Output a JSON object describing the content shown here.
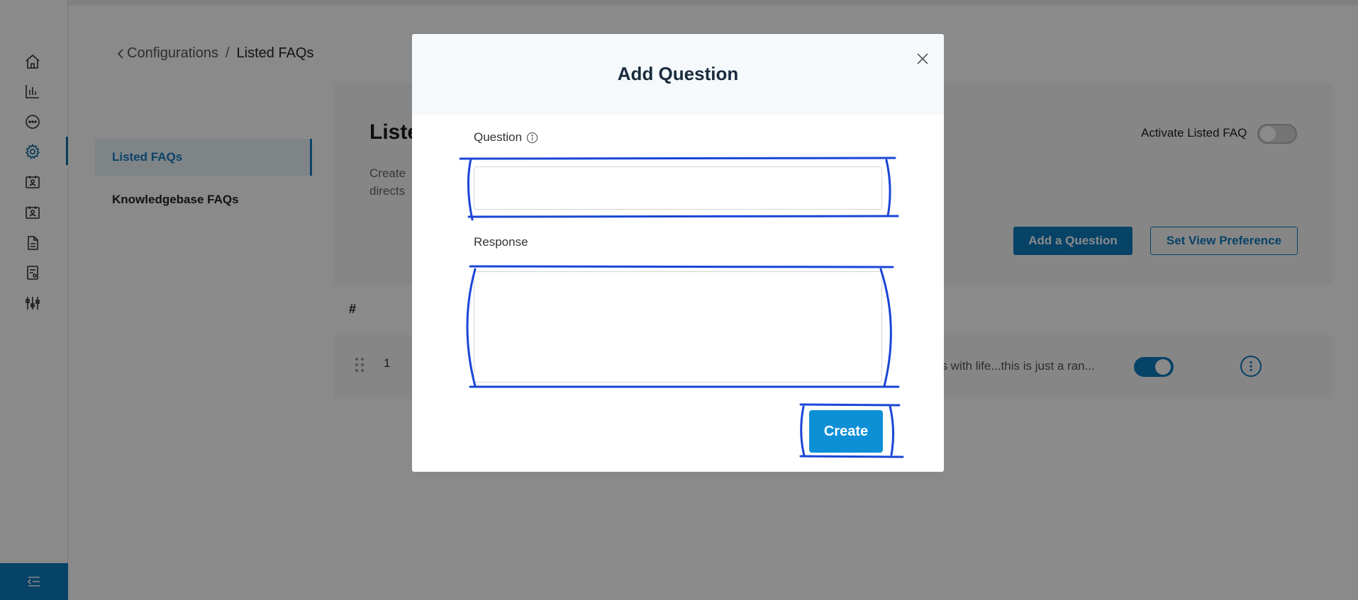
{
  "breadcrumb": {
    "parent": "Configurations",
    "separator": "/",
    "current": "Listed FAQs"
  },
  "sidebar": {
    "items": [
      {
        "icon": "home-icon"
      },
      {
        "icon": "bar-chart-icon"
      },
      {
        "icon": "chat-bubble-icon"
      },
      {
        "icon": "gear-icon",
        "active": true
      },
      {
        "icon": "contact-card-icon"
      },
      {
        "icon": "contact-card-icon"
      },
      {
        "icon": "document-icon"
      },
      {
        "icon": "report-icon"
      },
      {
        "icon": "sliders-icon"
      }
    ],
    "footer_icon": "collapse-menu-icon"
  },
  "subnav": {
    "items": [
      {
        "label": "Listed FAQs",
        "active": true
      },
      {
        "label": "Knowledgebase FAQs"
      }
    ]
  },
  "panel": {
    "title": "Liste",
    "description_line1": "Create",
    "description_line2": "directs",
    "activate_label": "Activate Listed FAQ",
    "activate_on": false,
    "add_button": "Add a Question",
    "view_pref_button": "Set View Preference"
  },
  "table": {
    "header_hash": "#",
    "rows": [
      {
        "number": "1",
        "text": "us with life...this is just a ran...",
        "enabled": true
      }
    ]
  },
  "modal": {
    "title": "Add Question",
    "question_label": "Question",
    "question_value": "",
    "response_label": "Response",
    "response_value": "",
    "create_button": "Create"
  },
  "colors": {
    "accent": "#0d7bbf",
    "create": "#0d8fd6",
    "annotation": "#1a45d6"
  }
}
